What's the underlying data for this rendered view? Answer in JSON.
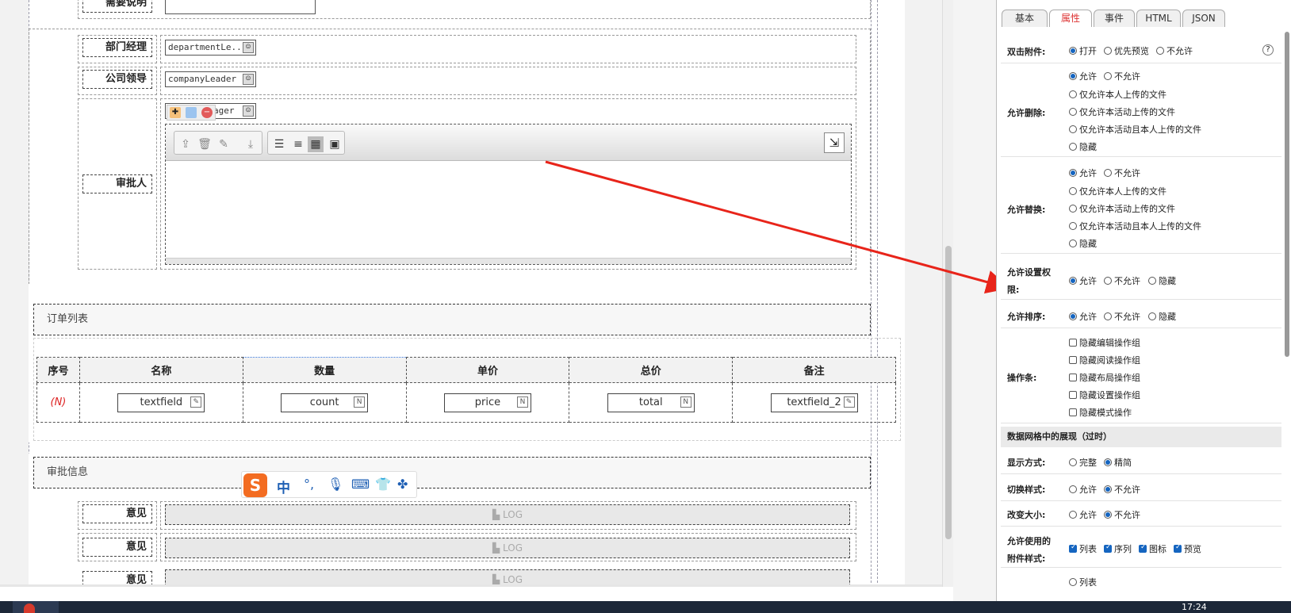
{
  "canvas": {
    "top_label": "需要说明",
    "rows": [
      {
        "label": "部门经理",
        "field": "departmentLe..."
      },
      {
        "label": "公司领导",
        "field": "companyLeader"
      },
      {
        "label": "审批人",
        "field": "ager"
      }
    ],
    "order_section": {
      "title": "订单列表",
      "columns": [
        "序号",
        "名称",
        "数量",
        "单价",
        "总价",
        "备注"
      ],
      "row": {
        "index": "(N)",
        "cells": [
          "textfield",
          "count",
          "price",
          "total",
          "textfield_2"
        ]
      }
    },
    "approval_section": {
      "title": "审批信息",
      "rows": [
        {
          "label": "意见",
          "log": "LOG"
        },
        {
          "label": "意见",
          "log": "LOG"
        },
        {
          "label": "意见",
          "log": "LOG"
        }
      ]
    },
    "ime_bar": {
      "text": "中"
    }
  },
  "panel": {
    "tabs": [
      "基本",
      "属性",
      "事件",
      "HTML",
      "JSON"
    ],
    "active_tab": "属性",
    "double_click": {
      "label": "双击附件:",
      "options": [
        "打开",
        "优先预览",
        "不允许"
      ],
      "selected": "打开"
    },
    "allow_delete": {
      "label": "允许删除:",
      "options": [
        "允许",
        "不允许",
        "仅允许本人上传的文件",
        "仅允许本活动上传的文件",
        "仅允许本活动且本人上传的文件",
        "隐藏"
      ]
    },
    "allow_replace": {
      "label": "允许替换:",
      "options": [
        "允许",
        "不允许",
        "仅允许本人上传的文件",
        "仅允许本活动上传的文件",
        "仅允许本活动且本人上传的文件",
        "隐藏"
      ]
    },
    "allow_perm": {
      "label_1": "允许设置权",
      "label_2": "限:",
      "options": [
        "允许",
        "不允许",
        "隐藏"
      ]
    },
    "allow_sort": {
      "label": "允许排序:",
      "options": [
        "允许",
        "不允许",
        "隐藏"
      ]
    },
    "toolbar": {
      "label": "操作条:",
      "options": [
        "隐藏编辑操作组",
        "隐藏阅读操作组",
        "隐藏布局操作组",
        "隐藏设置操作组",
        "隐藏模式操作"
      ]
    },
    "grid_section": "数据网格中的展现（过时）",
    "display_mode": {
      "label": "显示方式:",
      "options": [
        "完整",
        "精简"
      ]
    },
    "switch_style": {
      "label": "切换样式:",
      "options": [
        "允许",
        "不允许"
      ]
    },
    "resize": {
      "label": "改变大小:",
      "options": [
        "允许",
        "不允许"
      ]
    },
    "attach_styles": {
      "label_1": "允许使用的",
      "label_2": "附件样式:",
      "options": [
        "列表",
        "序列",
        "图标",
        "预览"
      ]
    },
    "default_style": {
      "options": [
        "列表"
      ]
    }
  },
  "taskbar": {
    "time": "17:24"
  },
  "colors": {
    "accent": "#1565c0",
    "active_tab": "#dd3333",
    "arrow": "#e8241a"
  }
}
